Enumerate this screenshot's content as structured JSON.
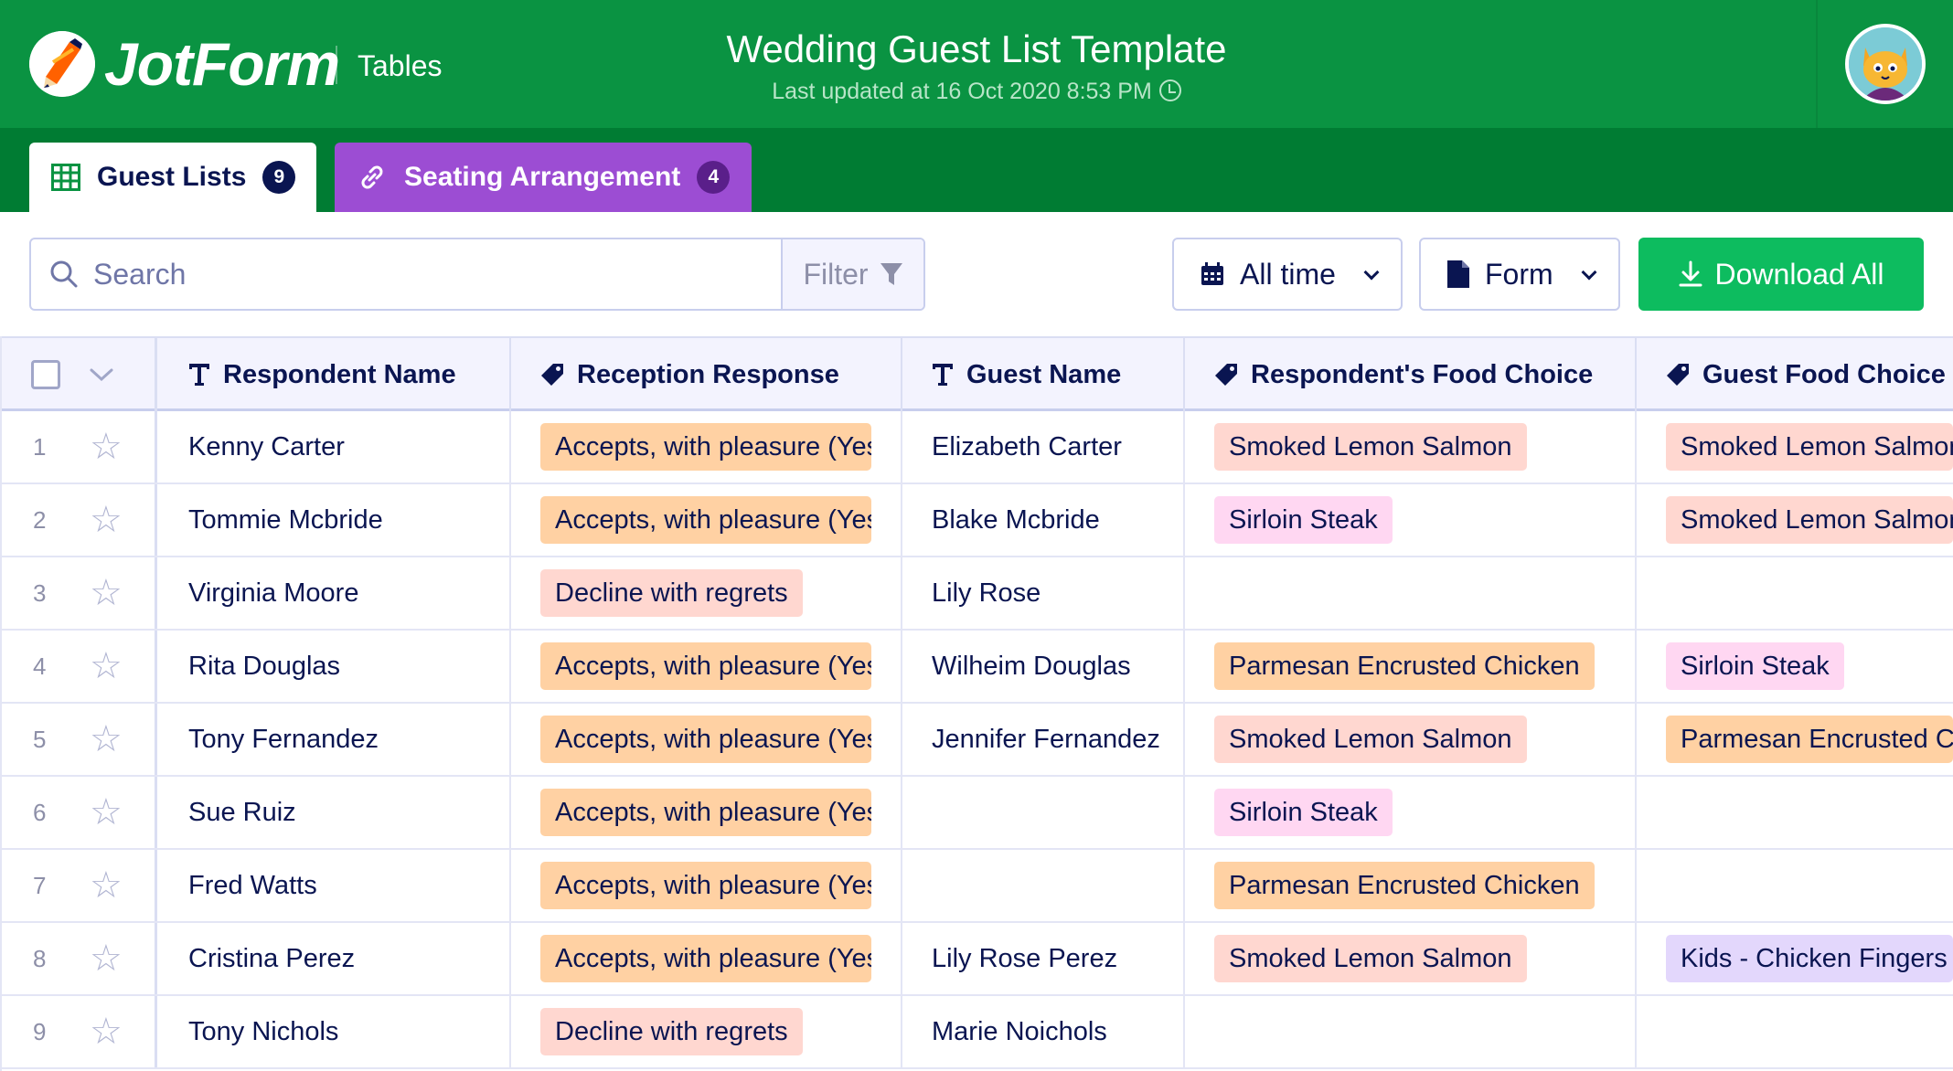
{
  "header": {
    "logo_text": "JotForm",
    "product": "Tables",
    "title": "Wedding Guest List Template",
    "last_updated": "Last updated at 16 Oct 2020 8:53 PM"
  },
  "tabs": [
    {
      "label": "Guest Lists",
      "count": "9"
    },
    {
      "label": "Seating Arrangement",
      "count": "4"
    }
  ],
  "toolbar": {
    "search_placeholder": "Search",
    "filter_label": "Filter",
    "time_dropdown": "All time",
    "form_dropdown": "Form",
    "download_label": "Download All"
  },
  "columns": [
    {
      "label": "Respondent Name",
      "icon": "text-type-icon"
    },
    {
      "label": "Reception Response",
      "icon": "tag-icon"
    },
    {
      "label": "Guest Name",
      "icon": "text-type-icon"
    },
    {
      "label": "Respondent's Food Choice",
      "icon": "tag-icon"
    },
    {
      "label": "Guest Food Choice",
      "icon": "tag-icon"
    }
  ],
  "rows": [
    {
      "num": "1",
      "respondent": "Kenny Carter",
      "response": "Accepts, with pleasure (Yes)",
      "guest": "Elizabeth Carter",
      "food": "Smoked Lemon Salmon",
      "guest_food": "Smoked Lemon Salmon"
    },
    {
      "num": "2",
      "respondent": "Tommie Mcbride",
      "response": "Accepts, with pleasure (Yes)",
      "guest": "Blake Mcbride",
      "food": "Sirloin Steak",
      "guest_food": "Smoked Lemon Salmon"
    },
    {
      "num": "3",
      "respondent": "Virginia Moore",
      "response": "Decline with regrets",
      "guest": "Lily Rose",
      "food": "",
      "guest_food": ""
    },
    {
      "num": "4",
      "respondent": "Rita Douglas",
      "response": "Accepts, with pleasure (Yes)",
      "guest": "Wilheim Douglas",
      "food": "Parmesan Encrusted Chicken",
      "guest_food": "Sirloin Steak"
    },
    {
      "num": "5",
      "respondent": "Tony Fernandez",
      "response": "Accepts, with pleasure (Yes)",
      "guest": "Jennifer Fernandez",
      "food": "Smoked Lemon Salmon",
      "guest_food": "Parmesan Encrusted Chicken"
    },
    {
      "num": "6",
      "respondent": "Sue Ruiz",
      "response": "Accepts, with pleasure (Yes)",
      "guest": "",
      "food": "Sirloin Steak",
      "guest_food": ""
    },
    {
      "num": "7",
      "respondent": "Fred Watts",
      "response": "Accepts, with pleasure (Yes)",
      "guest": "",
      "food": "Parmesan Encrusted Chicken",
      "guest_food": ""
    },
    {
      "num": "8",
      "respondent": "Cristina Perez",
      "response": "Accepts, with pleasure (Yes)",
      "guest": "Lily Rose Perez",
      "food": "Smoked Lemon Salmon",
      "guest_food": "Kids - Chicken Fingers & Fries"
    },
    {
      "num": "9",
      "respondent": "Tony Nichols",
      "response": "Decline with regrets",
      "guest": "Marie Noichols",
      "food": "",
      "guest_food": ""
    }
  ],
  "colors": {
    "header_green": "#0a9342",
    "tabbar_green": "#007c33",
    "seating_tab": "#9c4dd3",
    "download_button": "#0dbc5f"
  }
}
